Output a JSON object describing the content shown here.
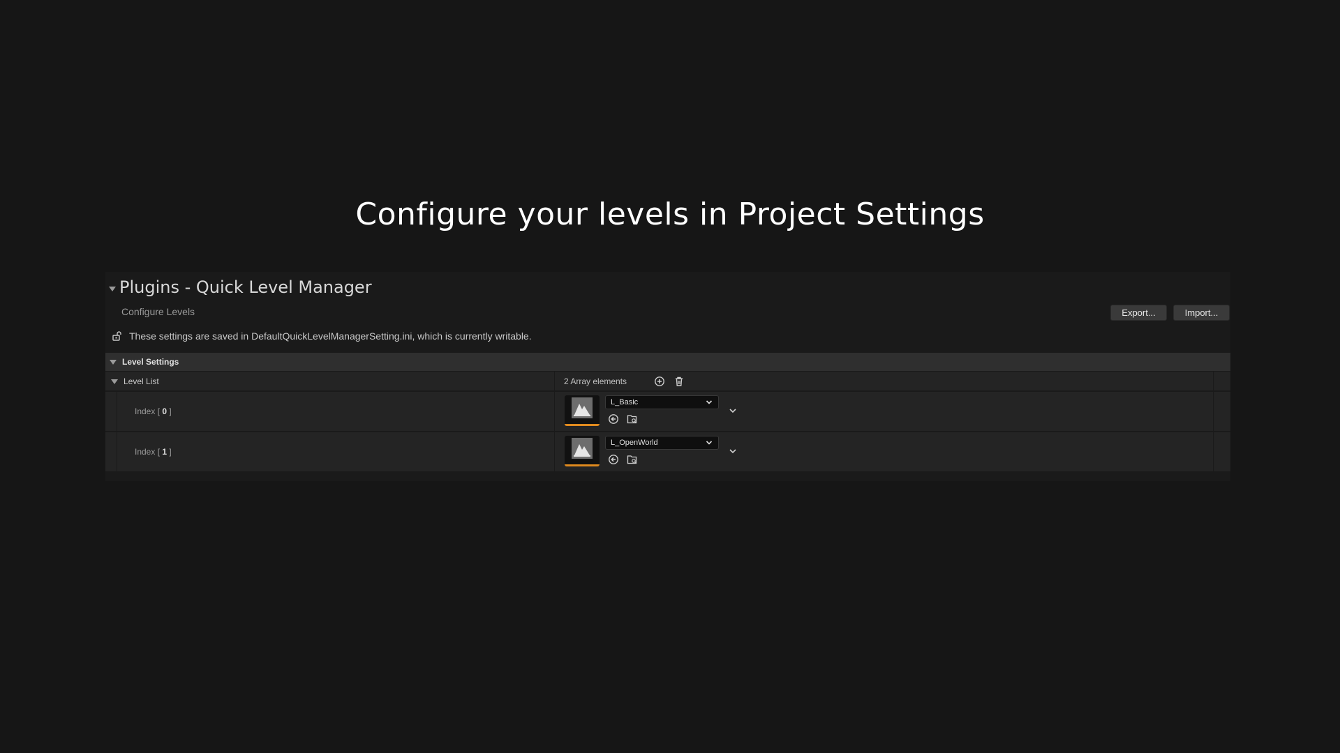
{
  "headline": "Configure your levels in Project Settings",
  "panel": {
    "title": "Plugins - Quick Level Manager",
    "subtitle": "Configure Levels",
    "export_label": "Export...",
    "import_label": "Import...",
    "notice": "These settings are saved in DefaultQuickLevelManagerSetting.ini, which is currently writable.",
    "category": "Level Settings",
    "level_list": {
      "label": "Level List",
      "count": "2 Array elements",
      "items": [
        {
          "index_prefix": "Index [ ",
          "index": "0",
          "index_suffix": " ]",
          "level": "L_Basic"
        },
        {
          "index_prefix": "Index [ ",
          "index": "1",
          "index_suffix": " ]",
          "level": "L_OpenWorld"
        }
      ]
    }
  },
  "colors": {
    "background": "#161616",
    "panel": "#1a1a1a",
    "row": "#242424",
    "category": "#2f2f2f",
    "accent": "#e08a1e"
  },
  "icons": {
    "collapse": "triangle-down-icon",
    "lock": "unlock-icon",
    "add": "plus-circle-icon",
    "delete": "trash-icon",
    "thumbnail": "level-map-icon",
    "use_selected": "arrow-left-circle-icon",
    "browse": "folder-search-icon",
    "dropdown": "chevron-down-icon"
  }
}
